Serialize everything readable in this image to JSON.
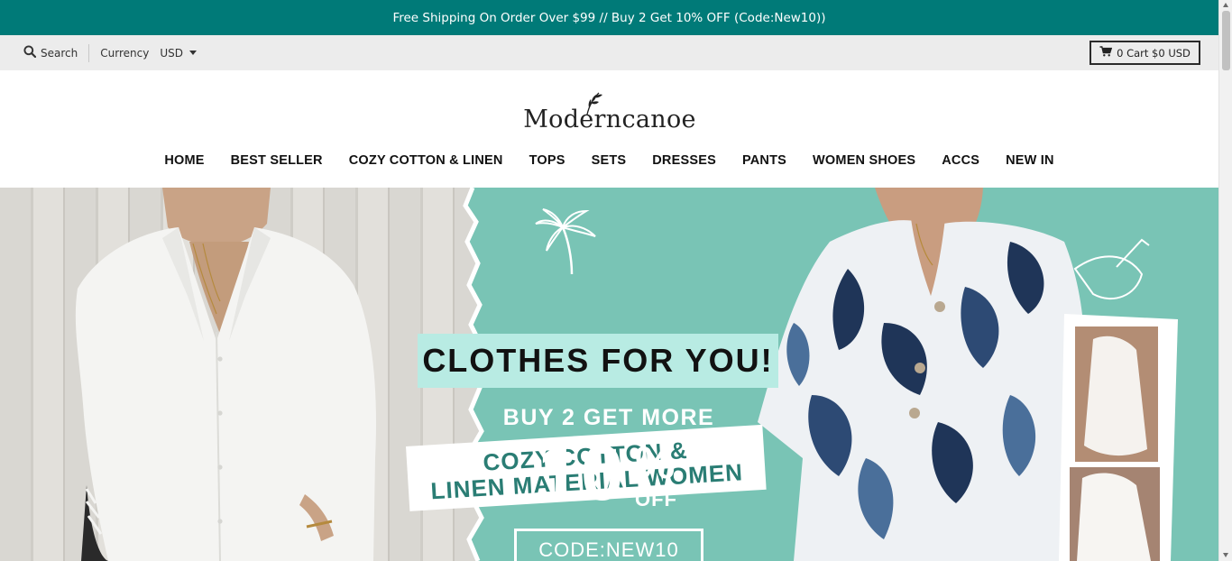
{
  "announcement": "Free Shipping On Order Over $99 // Buy 2 Get 10% OFF (Code:New10))",
  "utility": {
    "search_label": "Search",
    "currency_label": "Currency",
    "currency_value": "USD",
    "cart_label": "0 Cart $0 USD"
  },
  "logo": {
    "text": "Moderncanoe"
  },
  "nav": {
    "items": [
      "HOME",
      "BEST SELLER",
      "COZY COTTON & LINEN",
      "TOPS",
      "SETS",
      "DRESSES",
      "PANTS",
      "WOMEN SHOES",
      "ACCS",
      "NEW IN"
    ]
  },
  "hero": {
    "line1": "COZY COTTON &",
    "line2": "LINEN MATERIAL WOMEN",
    "headline": "CLOTHES FOR YOU!",
    "promo": "BUY 2 GET MORE",
    "percent": "10",
    "percent_sign": "%",
    "off": "OFF",
    "code": "CODE:NEW10"
  },
  "colors": {
    "announcement_bg": "#007a78",
    "utility_bg": "#ececec",
    "hero_teal": "#79c4b5",
    "highlight_mint": "#b8ebe3"
  }
}
